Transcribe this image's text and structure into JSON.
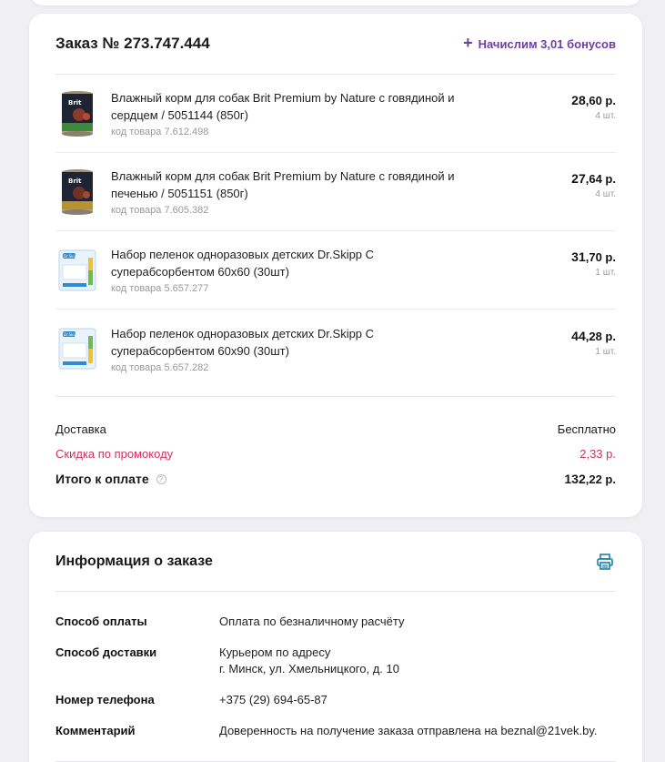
{
  "order": {
    "title": "Заказ № 273.747.444",
    "bonus_text": "Начислим 3,01 бонусов",
    "items": [
      {
        "name": "Влажный корм для собак Brit Premium by Nature с говядиной и сердцем / 5051144 (850г)",
        "code": "код товара 7.612.498",
        "price_rub": "28",
        "price_kop": ",60 р.",
        "qty": "4 шт.",
        "image": "brit-can"
      },
      {
        "name": "Влажный корм для собак Brit Premium by Nature с говядиной и печенью / 5051151 (850г)",
        "code": "код товара 7.605.382",
        "price_rub": "27",
        "price_kop": ",64 р.",
        "qty": "4 шт.",
        "image": "brit-can"
      },
      {
        "name": "Набор пеленок одноразовых детских Dr.Skipp С суперабсорбентом 60х60 (30шт)",
        "code": "код товара 5.657.277",
        "price_rub": "31",
        "price_kop": ",70 р.",
        "qty": "1 шт.",
        "image": "drskipp-pack"
      },
      {
        "name": "Набор пеленок одноразовых детских Dr.Skipp С суперабсорбентом 60х90 (30шт)",
        "code": "код товара 5.657.282",
        "price_rub": "44",
        "price_kop": ",28 р.",
        "qty": "1 шт.",
        "image": "drskipp-pack"
      }
    ],
    "delivery_label": "Доставка",
    "delivery_value": "Бесплатно",
    "promo_label": "Скидка по промокоду",
    "promo_value": "2,33 р.",
    "total_label": "Итого к оплате",
    "total_rub": "132",
    "total_kop": ",22 р.",
    "help_icon": "?"
  },
  "info": {
    "title": "Информация о заказе",
    "print_icon": "printer-icon",
    "rows": [
      {
        "label": "Способ оплаты",
        "value": "Оплата по безналичному расчёту",
        "value2": ""
      },
      {
        "label": "Способ доставки",
        "value": "Курьером по адресу",
        "value2": "г. Минск, ул. Хмельницкого, д. 10"
      },
      {
        "label": "Номер телефона",
        "value": "+375 (29) 694-65-87",
        "value2": ""
      },
      {
        "label": "Комментарий",
        "value": "Доверенность на получение заказа отправлена на beznal@21vek.by.",
        "value2": ""
      }
    ]
  },
  "colors": {
    "accent": "#6b3fa0",
    "promo": "#d0325f",
    "print": "#1a7fa8"
  }
}
